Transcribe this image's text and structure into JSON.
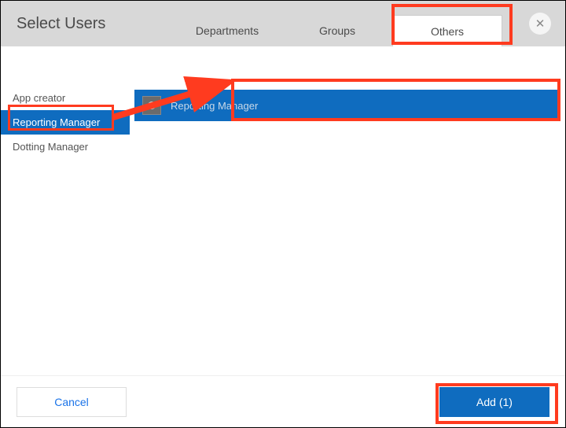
{
  "header": {
    "title": "Select Users"
  },
  "tabs": {
    "departments": "Departments",
    "groups": "Groups",
    "others": "Others",
    "active": "others"
  },
  "sidebar": {
    "items": [
      {
        "label": "App creator"
      },
      {
        "label": "Reporting Manager"
      },
      {
        "label": "Dotting Manager"
      }
    ],
    "selected_index": 1
  },
  "main": {
    "selected_item_label": "Reporting Manager"
  },
  "footer": {
    "cancel_label": "Cancel",
    "add_label": "Add (1)"
  },
  "icons": {
    "close": "✕"
  },
  "colors": {
    "accent": "#0f6cbf",
    "annotation": "#ff3b1f",
    "header_bg": "#d8d8d8"
  }
}
